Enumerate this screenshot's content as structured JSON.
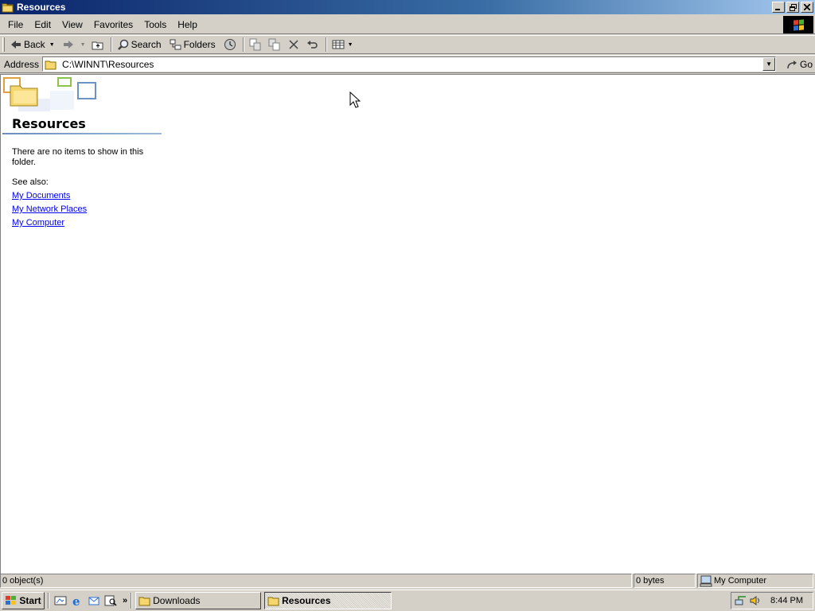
{
  "window": {
    "title": "Resources"
  },
  "menu": [
    "File",
    "Edit",
    "View",
    "Favorites",
    "Tools",
    "Help"
  ],
  "toolbar": {
    "back_label": "Back",
    "search_label": "Search",
    "folders_label": "Folders"
  },
  "address": {
    "label": "Address",
    "path": "C:\\WINNT\\Resources",
    "go_label": "Go"
  },
  "content": {
    "folder_name": "Resources",
    "empty_message": "There are no items to show in this folder.",
    "see_also_label": "See also:",
    "links": [
      "My Documents",
      "My Network Places",
      "My Computer"
    ]
  },
  "statusbar": {
    "objects": "0 object(s)",
    "size": "0 bytes",
    "zone": "My Computer"
  },
  "taskbar": {
    "start_label": "Start",
    "tasks": [
      {
        "label": "Downloads",
        "active": false
      },
      {
        "label": "Resources",
        "active": true
      }
    ],
    "clock": "8:44 PM"
  },
  "colors": {
    "title_active": "#0a246a",
    "face": "#d4d0c8",
    "link": "#0000ee"
  }
}
